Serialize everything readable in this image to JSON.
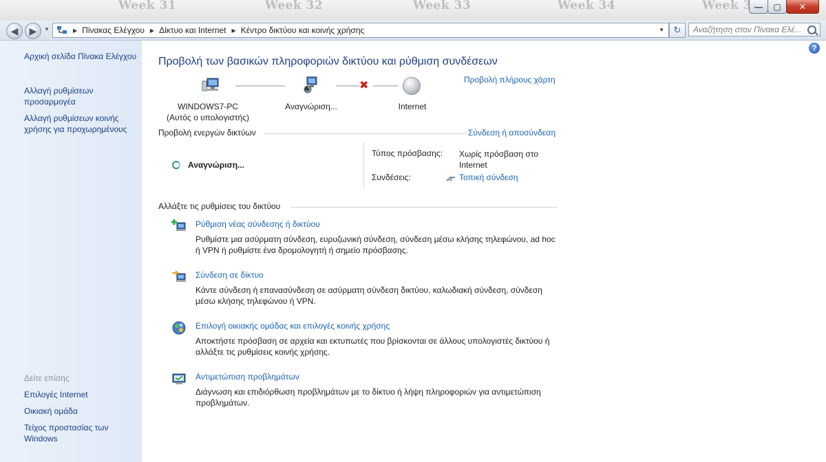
{
  "titlebar": {
    "weeks": [
      "Week 31",
      "Week 32",
      "Week 33",
      "Week 34",
      "Week 3"
    ],
    "minimize": "—",
    "maximize": "▢",
    "close": "✕"
  },
  "nav": {
    "back_icon": "back-arrow-icon",
    "forward_icon": "forward-arrow-icon",
    "breadcrumb": [
      "Πίνακας Ελέγχου",
      "Δίκτυο και Internet",
      "Κέντρο δικτύου και κοινής χρήσης"
    ],
    "search_placeholder": "Αναζήτηση στον Πίνακα Ελέ..."
  },
  "sidebar": {
    "links": [
      "Αρχική σελίδα Πίνακα Ελέγχου",
      "Αλλαγή ρυθμίσεων προσαρμογέα",
      "Αλλαγή ρυθμίσεων κοινής χρήσης για προχωρημένους"
    ],
    "see_also_title": "Δείτε επίσης",
    "see_also": [
      "Επιλογές Internet",
      "Οικιακή ομάδα",
      "Τείχος προστασίας των Windows"
    ]
  },
  "main": {
    "title": "Προβολή των βασικών πληροφοριών δικτύου και ρύθμιση συνδέσεων",
    "full_map_link": "Προβολή πλήρους χάρτη",
    "map": {
      "computer_name": "WINDOWS7-PC",
      "computer_sub": "(Αυτός ο υπολογιστής)",
      "network_label": "Αναγνώριση...",
      "internet_label": "Internet"
    },
    "active_networks": {
      "title": "Προβολή ενεργών δικτύων",
      "connect_link": "Σύνδεση ή αποσύνδεση",
      "network_name": "Αναγνώριση...",
      "access_type_label": "Τύπος πρόσβασης:",
      "access_type_value": "Χωρίς πρόσβαση στο Internet",
      "connections_label": "Συνδέσεις:",
      "connections_value": "Τοπική σύνδεση"
    },
    "change_settings": {
      "title": "Αλλάξτε τις ρυθμίσεις του δικτύου",
      "tasks": [
        {
          "title": "Ρύθμιση νέας σύνδεσης ή δικτύου",
          "desc": "Ρυθμίστε μια ασύρματη σύνδεση, ευρυζωνική σύνδεση,  σύνδεση μέσω κλήσης τηλεφώνου, ad hoc ή VPN ή ρυθμίστε ένα δρομολογητή ή σημείο πρόσβασης."
        },
        {
          "title": "Σύνδεση σε δίκτυο",
          "desc": "Κάντε σύνδεση ή επανασύνδεση σε ασύρματη σύνδεση δικτύου, καλωδιακή σύνδεση, σύνδεση μέσω κλήσης τηλεφώνου ή VPN."
        },
        {
          "title": "Επιλογή οικιακής ομάδας και επιλογές κοινής χρήσης",
          "desc": "Αποκτήστε πρόσβαση σε αρχεία και εκτυπωτές που βρίσκονται σε άλλους υπολογιστές δικτύου ή αλλάξτε τις ρυθμίσεις κοινής χρήσης."
        },
        {
          "title": "Αντιμετώπιση προβλημάτων",
          "desc": "Διάγνωση και επιδιόρθωση προβλημάτων με το δίκτυο ή λήψη πληροφοριών για αντιμετώπιση προβλημάτων."
        }
      ]
    }
  },
  "colors": {
    "link": "#1b63b7",
    "title": "#1e3e83",
    "left_pane": "#e4edf8"
  }
}
